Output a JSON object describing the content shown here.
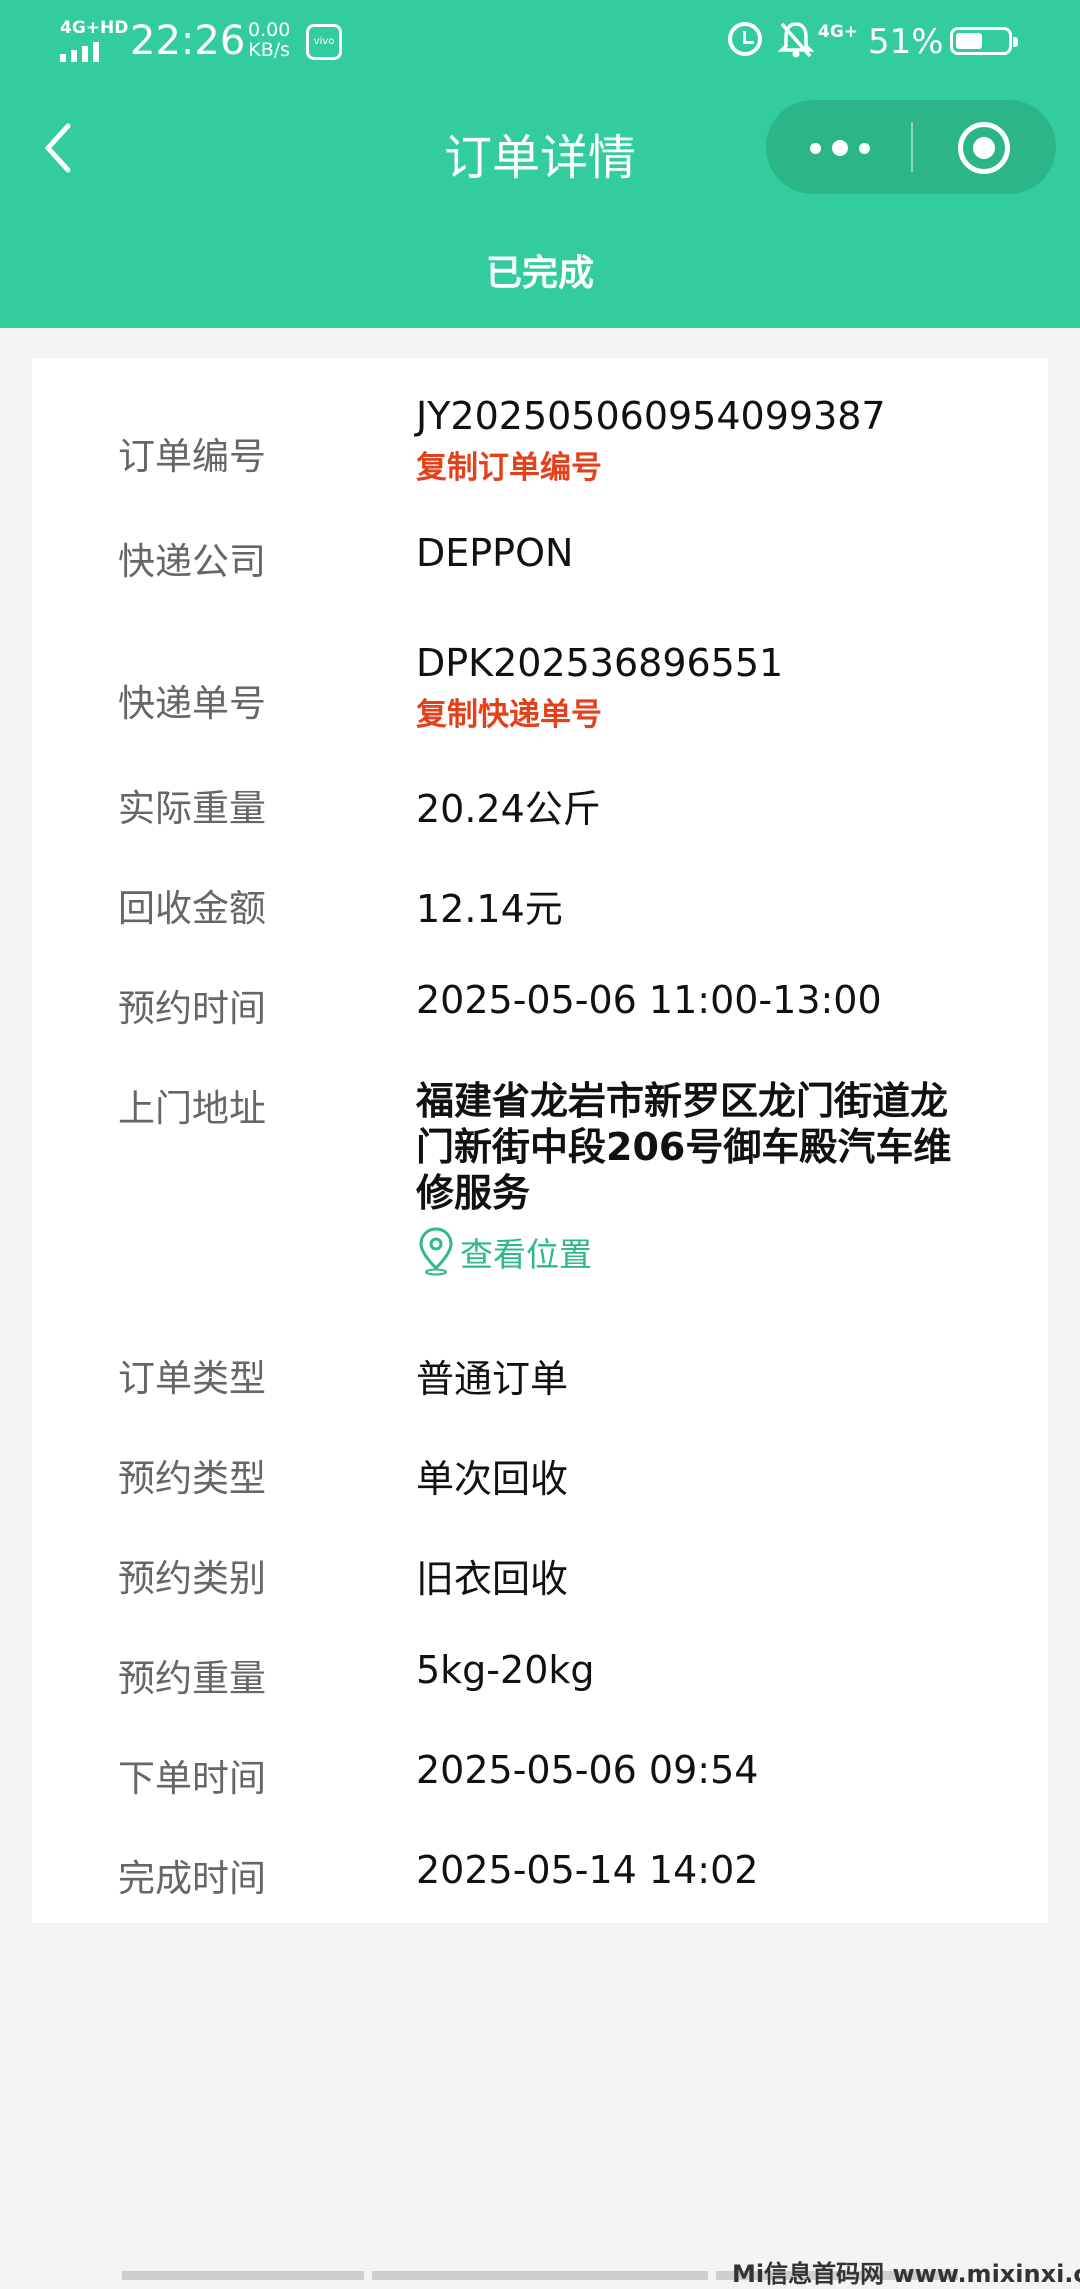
{
  "status_bar": {
    "network": "4G+HD",
    "time": "22:26",
    "speed_value": "0.00",
    "speed_unit": "KB/s",
    "app_badge": "vivo",
    "network2": "4G+",
    "battery": "51%"
  },
  "header": {
    "title": "订单详情",
    "order_status": "已完成"
  },
  "colors": {
    "brand": "#33cc9c",
    "copy_link": "#e5401c",
    "location_link": "#2fb989"
  },
  "details": {
    "order_no_label": "订单编号",
    "order_no": "JY202505060954099387",
    "copy_order_no": "复制订单编号",
    "courier_label": "快递公司",
    "courier": "DEPPON",
    "tracking_label": "快递单号",
    "tracking_no": "DPK202536896551",
    "copy_tracking": "复制快递单号",
    "weight_label": "实际重量",
    "weight": "20.24公斤",
    "amount_label": "回收金额",
    "amount": "12.14元",
    "appt_time_label": "预约时间",
    "appt_time": "2025-05-06 11:00-13:00",
    "address_label": "上门地址",
    "address": "福建省龙岩市新罗区龙门街道龙门新街中段206号御车殿汽车维修服务",
    "view_location": "查看位置",
    "order_type_label": "订单类型",
    "order_type": "普通订单",
    "appt_type_label": "预约类型",
    "appt_type": "单次回收",
    "appt_category_label": "预约类别",
    "appt_category": "旧衣回收",
    "appt_weight_label": "预约重量",
    "appt_weight": "5kg-20kg",
    "order_time_label": "下单时间",
    "order_time": "2025-05-06 09:54",
    "complete_time_label": "完成时间",
    "complete_time": "2025-05-14 14:02"
  },
  "watermark": "Mi信息首码网 www.mixinxi.com"
}
